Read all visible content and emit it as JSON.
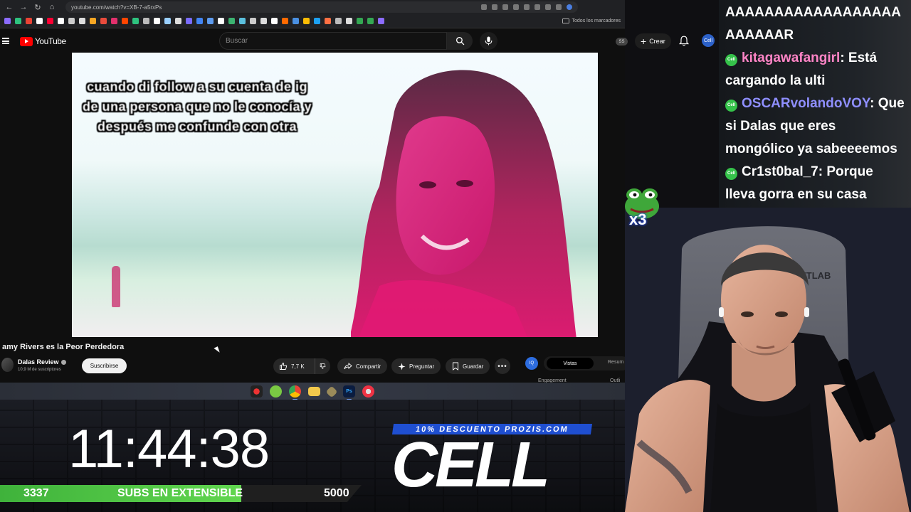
{
  "browser": {
    "url": "youtube.com/watch?v=XB-7-a5rxPs",
    "bookmarks_folder": "Todos los marcadores"
  },
  "youtube": {
    "logo_text": "YouTube",
    "search_placeholder": "Buscar",
    "badge_text": "SS",
    "create_label": "Crear",
    "avatar_text": "Cell"
  },
  "video": {
    "caption": "cuando di follow a su cuenta de ig de una persona que no le conocía y después me confunde con otra"
  },
  "watch": {
    "title": "amy Rivers es la Peor Perdedora",
    "channel_name": "Dalas Review",
    "channel_subs": "10,9 M de suscriptores",
    "subscribe_label": "Suscribirse",
    "likes": "7,7 K",
    "share_label": "Compartir",
    "ask_label": "Preguntar",
    "save_label": "Guardar",
    "more_label": "•••"
  },
  "side_panel": {
    "tab_views": "Vistas",
    "tab_summary": "Resum",
    "label_engagement": "Engagement",
    "label_outline": "Outli",
    "logo_text": "IQ"
  },
  "chat": {
    "lines": [
      {
        "user": "",
        "message": "AAAAAAAAAAAAAAAAAAAAAAAAR"
      },
      {
        "user": "kitagawafangirl",
        "message": ": Está cargando la ulti"
      },
      {
        "user": "OSCARvolandoVOY",
        "message": ": Que si Dalas que eres mongólico ya sabeeeemos"
      },
      {
        "user": "Cr1st0bal_7",
        "message": ": Porque lleva gorra en su casa"
      }
    ],
    "badge_text": "Cell"
  },
  "overlay": {
    "timer": "11:44:38",
    "subs_current": "3337",
    "subs_label": "SUBS EN EXTENSIBLE",
    "subs_goal": "5000",
    "subs_progress": 0.6674,
    "promo": "10% DESCUENTO PROZIS.COM",
    "brand": "CELL",
    "emote_text": "x3"
  },
  "colors": {
    "yt_red": "#ff0000",
    "progress_green": "#4cc442",
    "promo_blue": "#1f4fd1",
    "chat_pink": "#ff84c6",
    "chat_purple": "#8f8fff"
  },
  "icons": [
    "back-icon",
    "forward-icon",
    "reload-icon",
    "home-icon",
    "menu-icon",
    "search-icon",
    "mic-icon",
    "plus-icon",
    "bell-icon",
    "like-icon",
    "dislike-icon",
    "share-icon",
    "sparkle-icon",
    "bookmark-icon"
  ]
}
